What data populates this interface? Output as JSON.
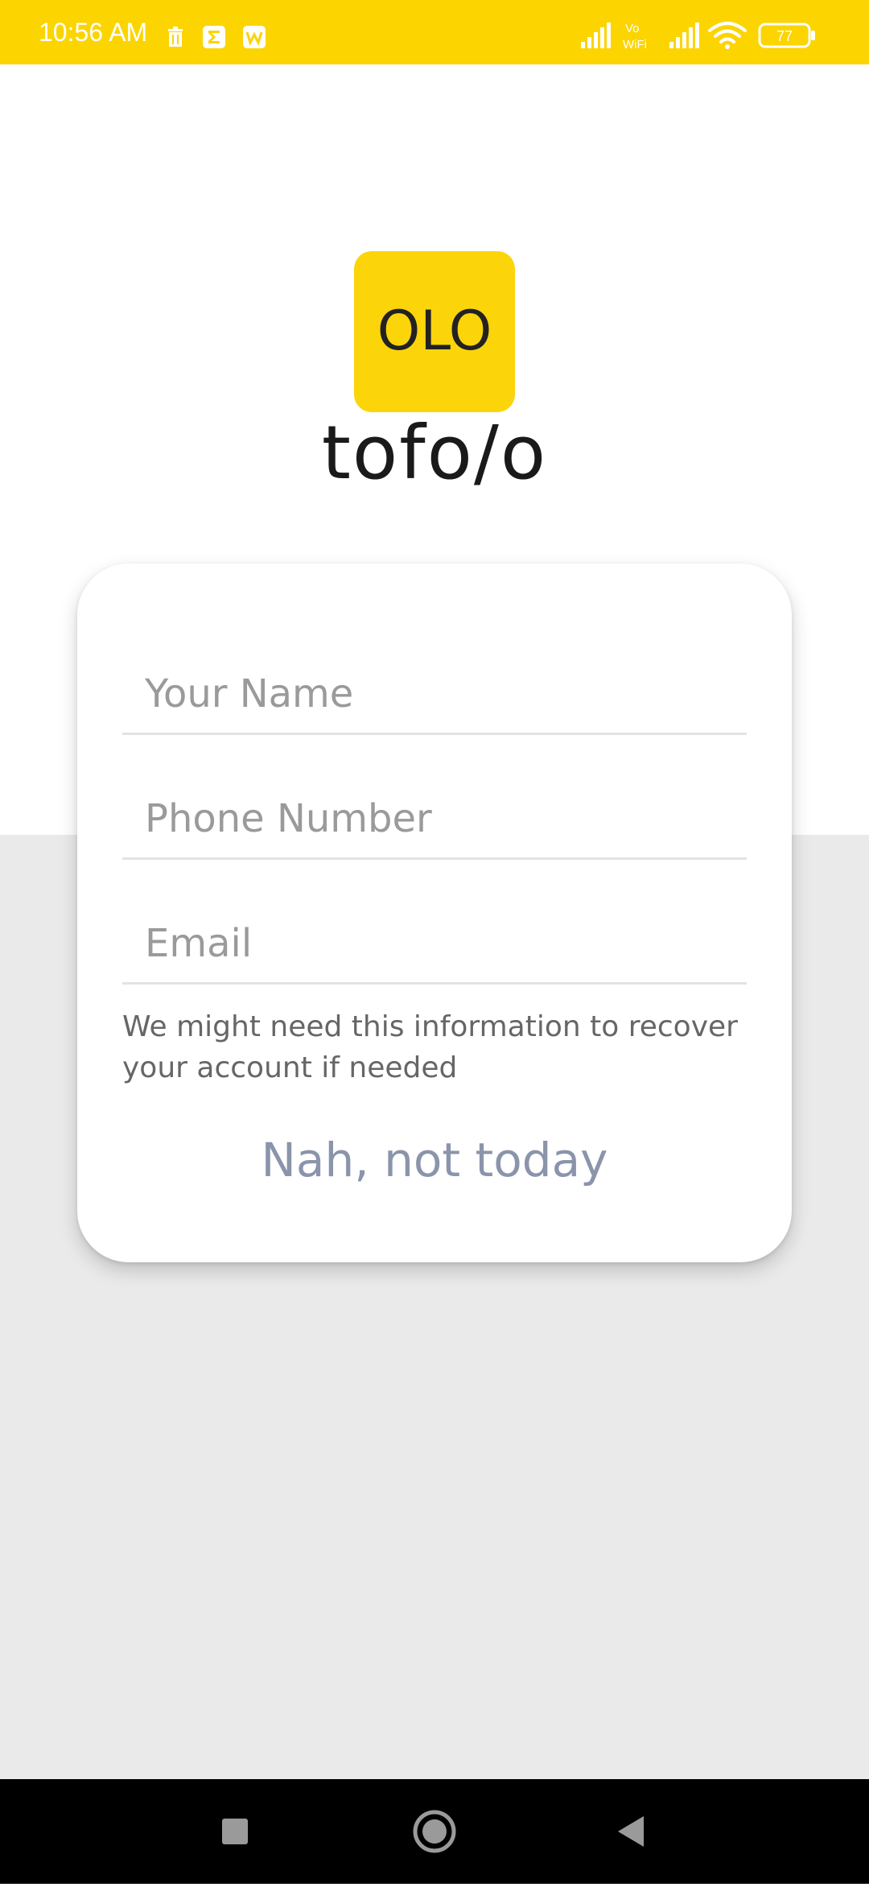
{
  "status_bar": {
    "time": "10:56 AM",
    "battery": "77",
    "notification_icons": [
      "delete-icon",
      "sigma-icon",
      "wps-icon"
    ],
    "network_label_top": "Vo",
    "network_label_bottom": "WiFi"
  },
  "brand": {
    "logo_text": "OLO",
    "name": "tofo/o"
  },
  "form": {
    "name_placeholder": "Your Name",
    "phone_placeholder": "Phone Number",
    "email_placeholder": "Email",
    "helper_text": "We might need this information to recover your account if needed",
    "skip_label": "Nah, not today"
  },
  "navigation": {
    "buttons": [
      "recents-button",
      "home-button",
      "back-button"
    ]
  },
  "colors": {
    "accent": "#FCD400",
    "skip_text": "#8A94AA",
    "bottom_background": "#EAEAEA"
  }
}
